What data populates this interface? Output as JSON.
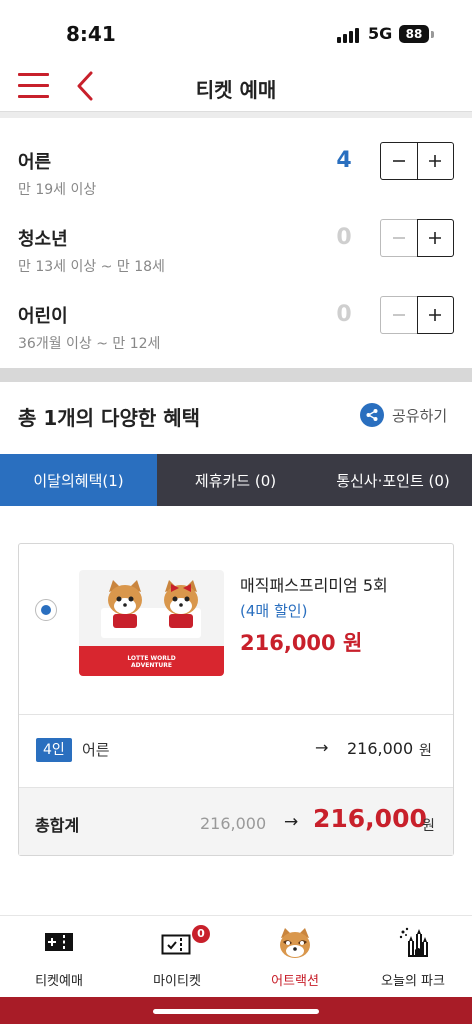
{
  "status_bar": {
    "time": "8:41",
    "network": "5G",
    "battery": "88"
  },
  "header": {
    "title": "티켓 예매"
  },
  "tickets": [
    {
      "name": "어른",
      "sub": "만 19세 이상",
      "count": "4"
    },
    {
      "name": "청소년",
      "sub": "만 13세 이상 ~ 만 18세",
      "count": "0"
    },
    {
      "name": "어린이",
      "sub": "36개월 이상 ~ 만 12세",
      "count": "0"
    }
  ],
  "benefits": {
    "title": "총 1개의 다양한 혜택",
    "share_label": "공유하기"
  },
  "tabs": [
    {
      "label": "이달의혜택(1)",
      "active": true
    },
    {
      "label": "제휴카드 (0)",
      "active": false
    },
    {
      "label": "통신사·포인트 (0)",
      "active": false
    }
  ],
  "product": {
    "name": "매직패스프리미엄 5회",
    "discount": "(4매 할인)",
    "price": "216,000 원",
    "image_text_line1": "LOTTE WORLD",
    "image_text_line2": "ADVENTURE"
  },
  "line_item": {
    "qty": "4인",
    "type": "어른",
    "arrow": "→",
    "amount": "216,000",
    "unit": "원"
  },
  "total": {
    "label": "총합계",
    "original": "216,000",
    "arrow": "→",
    "amount": "216,000",
    "unit": "원"
  },
  "bottom_nav": [
    {
      "label": "티켓예매",
      "icon": "ticket-plus-icon"
    },
    {
      "label": "마이티켓",
      "icon": "my-ticket-icon",
      "badge": "0"
    },
    {
      "label": "어트랙션",
      "icon": "lotty-mascot-icon",
      "active": true
    },
    {
      "label": "오늘의 파크",
      "icon": "park-castle-icon"
    }
  ],
  "colors": {
    "accent_red": "#c8202b",
    "accent_blue": "#2a6fbf",
    "tab_dark": "#3a3a44",
    "footer_red": "#a81c27"
  }
}
